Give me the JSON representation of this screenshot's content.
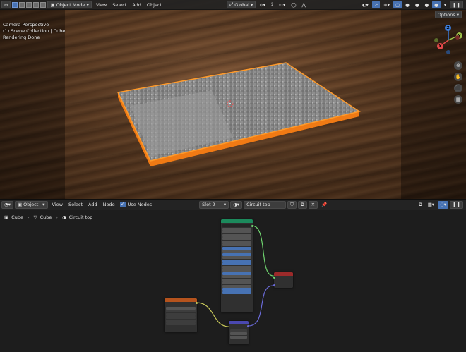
{
  "viewport_header": {
    "mode": "Object Mode",
    "menus": [
      "View",
      "Select",
      "Add",
      "Object"
    ],
    "transform_orientation": "Global",
    "options_label": "Options"
  },
  "viewport_overlay": {
    "line1": "Camera Perspective",
    "line2": "(1) Scene Collection | Cube",
    "line3": "Rendering Done"
  },
  "gizmo": {
    "x": "X",
    "y": "Y",
    "z": "Z"
  },
  "node_header": {
    "editor_type": "Object",
    "menus": [
      "View",
      "Select",
      "Add",
      "Node"
    ],
    "use_nodes_label": "Use Nodes",
    "slot": "Slot 2",
    "material": "Circuit top"
  },
  "breadcrumb": [
    "Cube",
    "Cube",
    "Circuit top"
  ],
  "colors": {
    "accent": "#4772b3",
    "selection": "#ff8a1a",
    "shader_header": "#1c8a5c",
    "texture_header": "#b5531d",
    "vector_header": "#4a48b0",
    "output_header": "#9c2a2a"
  }
}
